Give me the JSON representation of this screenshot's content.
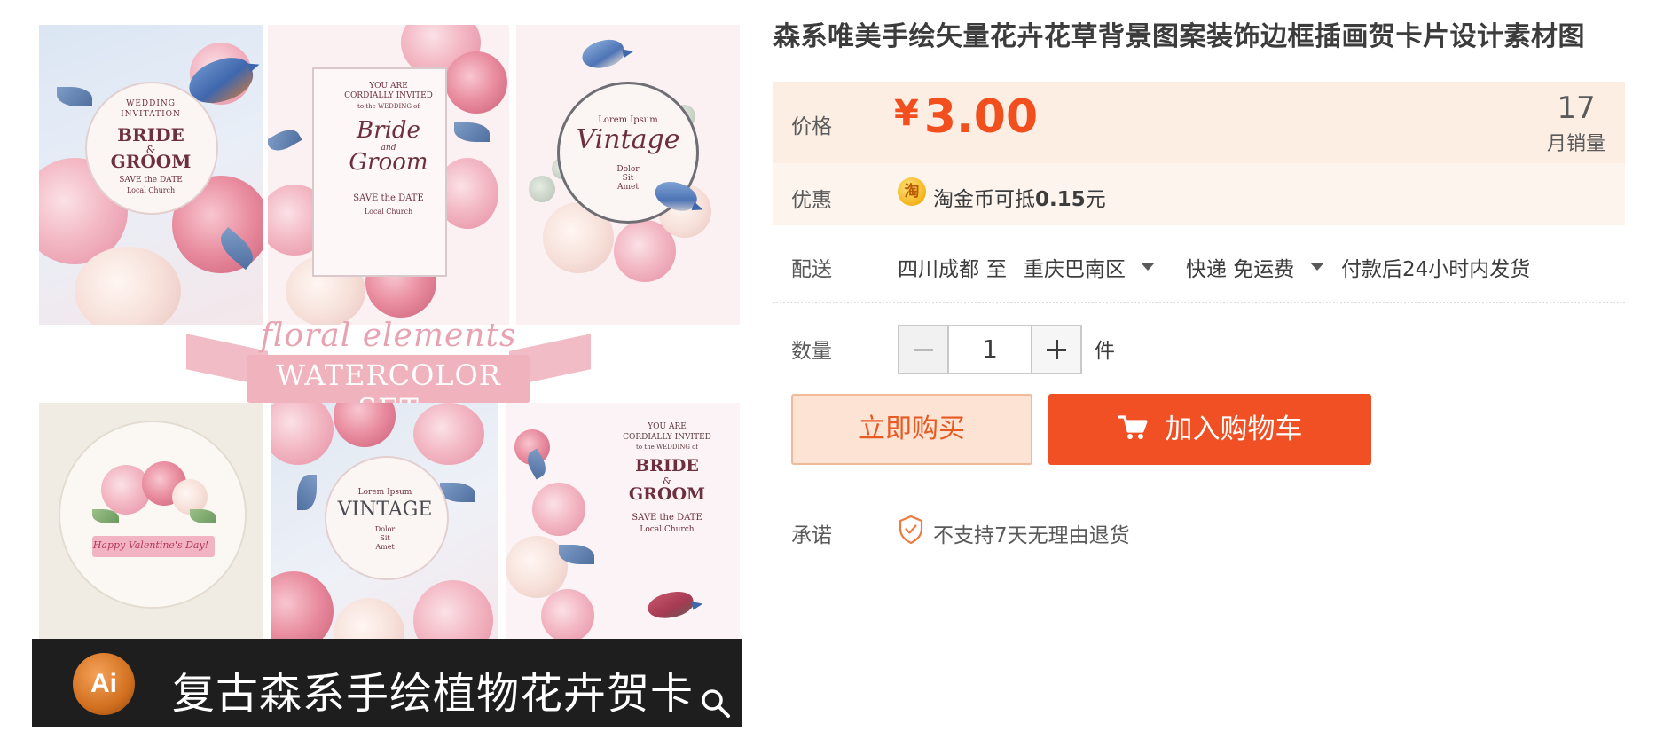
{
  "gallery": {
    "cards": {
      "c1": {
        "line1": "WEDDING",
        "line2": "INVITATION",
        "line3": "BRIDE",
        "line4": "&",
        "line5": "GROOM",
        "line6": "SAVE the DATE",
        "line7": "Local Church"
      },
      "c2": {
        "line1": "YOU ARE",
        "line2": "CORDIALLY INVITED",
        "line3": "to the WEDDING of",
        "line4": "Bride",
        "line5": "and",
        "line6": "Groom",
        "line7": "SAVE the DATE",
        "line8": "Local Church"
      },
      "c3": {
        "line1": "Lorem Ipsum",
        "line2": "Vintage",
        "line3": "Dolor",
        "line4": "Sit",
        "line5": "Amet"
      },
      "c4": {
        "line1": "Happy Valentine's Day!"
      },
      "c5": {
        "line1": "Lorem Ipsum",
        "line2": "VINTAGE",
        "line3": "Dolor",
        "line4": "Sit",
        "line5": "Amet"
      },
      "c6": {
        "line1": "YOU ARE",
        "line2": "CORDIALLY INVITED",
        "line3": "to the WEDDING of",
        "line4": "BRIDE",
        "line5": "&",
        "line6": "GROOM",
        "line7": "SAVE the DATE",
        "line8": "Local Church"
      }
    },
    "ribbon_line1": "floral elements",
    "ribbon_line2": "WATERCOLOR SET",
    "banner_badge": "Ai",
    "banner_text": "复古森系手绘植物花卉贺卡",
    "zoom_icon": "magnifier-icon"
  },
  "product": {
    "title": "森系唯美手绘矢量花卉花草背景图案装饰边框插画贺卡片设计素材图",
    "price_label": "价格",
    "currency": "¥",
    "price": "3.00",
    "monthly_sales_count": "17",
    "monthly_sales_label": "月销量",
    "promo_label": "优惠",
    "promo_coin": "淘",
    "promo_text_prefix": "淘金币可抵",
    "promo_amount": "0.15",
    "promo_text_suffix": "元",
    "shipping_label": "配送",
    "ship_from": "四川成都",
    "ship_to_word": "至",
    "ship_to": "重庆巴南区",
    "ship_method": "快递 免运费",
    "ship_time": "付款后24小时内发货",
    "quantity_label": "数量",
    "quantity_value": "1",
    "quantity_unit": "件",
    "buy_now_label": "立即购买",
    "add_to_cart_label": "加入购物车",
    "promise_label": "承诺",
    "promise_text": "不支持7天无理由退货"
  },
  "colors": {
    "accent": "#f05024",
    "price": "#f24f1e",
    "price_bg": "#fceee3",
    "promo_bg": "#fdf4ee",
    "buy_now_bg": "#fde3d3"
  }
}
